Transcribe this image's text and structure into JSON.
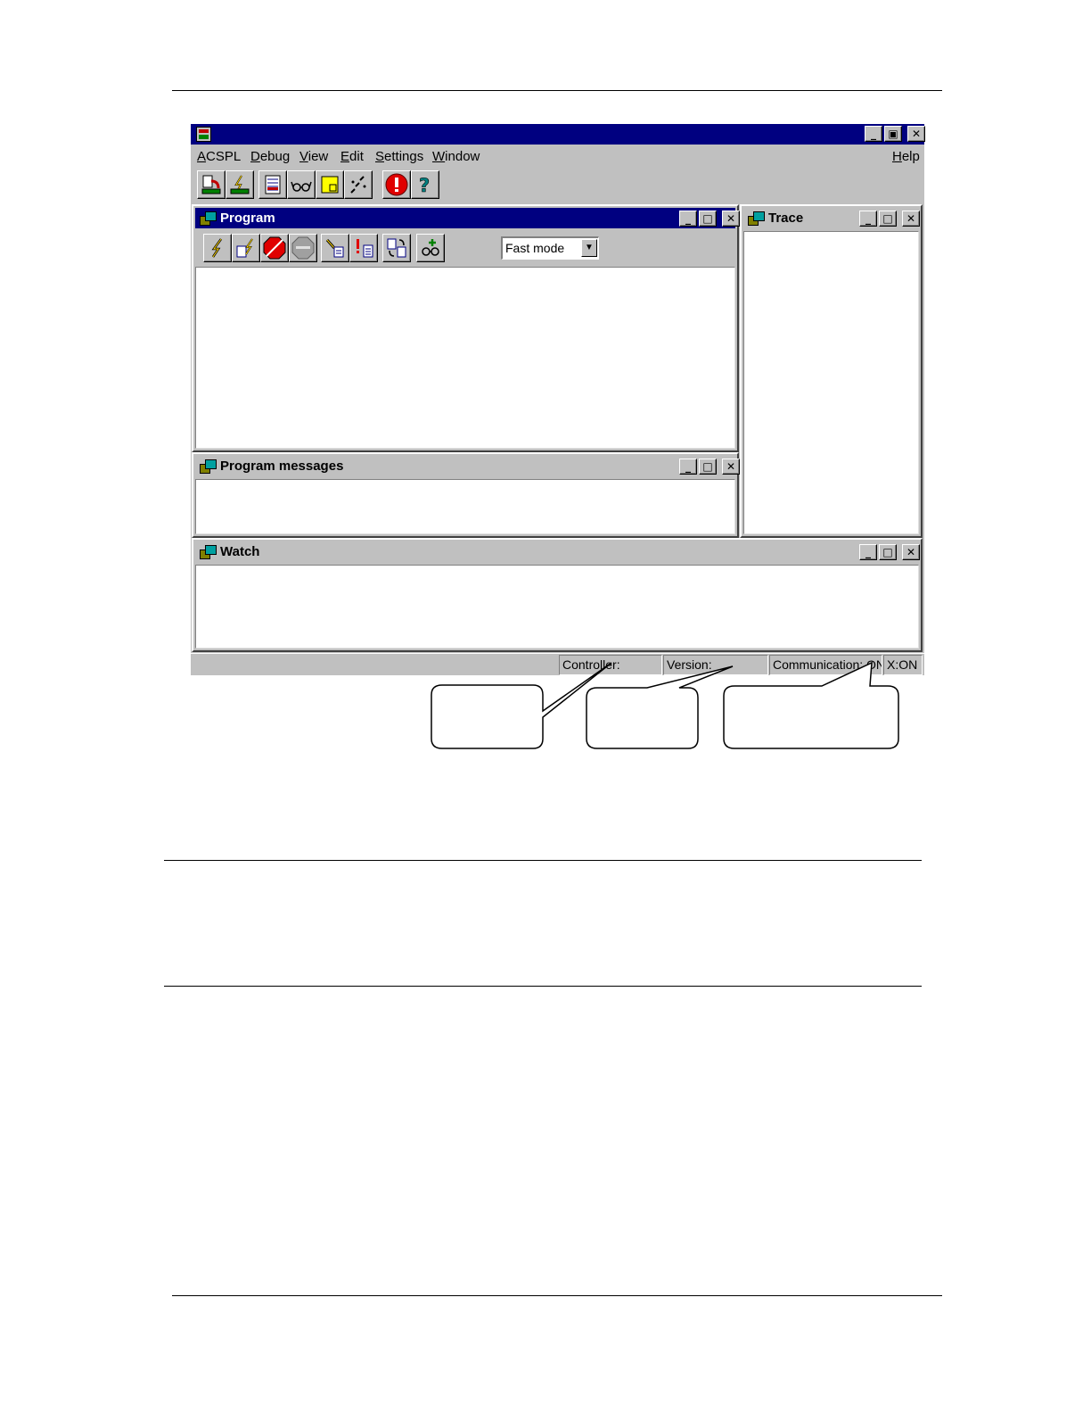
{
  "app": {
    "menu": [
      "ACSPL",
      "Debug",
      "View",
      "Edit",
      "Settings",
      "Window"
    ],
    "help_menu": "Help",
    "toolbar_icons": [
      "download-icon",
      "compile-icon",
      "grid-icon",
      "glasses-icon",
      "note-icon",
      "scatter-icon",
      "alert-icon",
      "help-icon"
    ]
  },
  "windows": {
    "program": {
      "title": "Program",
      "mode_select": {
        "selected": "Fast mode"
      },
      "toolbar_icons": [
        "run-icon",
        "compile-to-buffer-icon",
        "stop-icon",
        "stop-all-icon",
        "search-buffer-icon",
        "error-buffer-icon",
        "swap-buffer-icon",
        "add-watch-icon"
      ]
    },
    "messages": {
      "title": "Program messages"
    },
    "trace": {
      "title": "Trace"
    },
    "watch": {
      "title": "Watch"
    }
  },
  "caption_glyphs": {
    "minimize": "_",
    "maximize": "□",
    "restore": "▣",
    "close": "✕"
  },
  "statusbar": {
    "controller": "Controller:",
    "version": "Version:",
    "communication": "Communication: ON",
    "xon": "X:ON"
  },
  "colors": {
    "titlebar_active": "#000080",
    "face": "#c0c0c0",
    "client": "#ffffff"
  }
}
